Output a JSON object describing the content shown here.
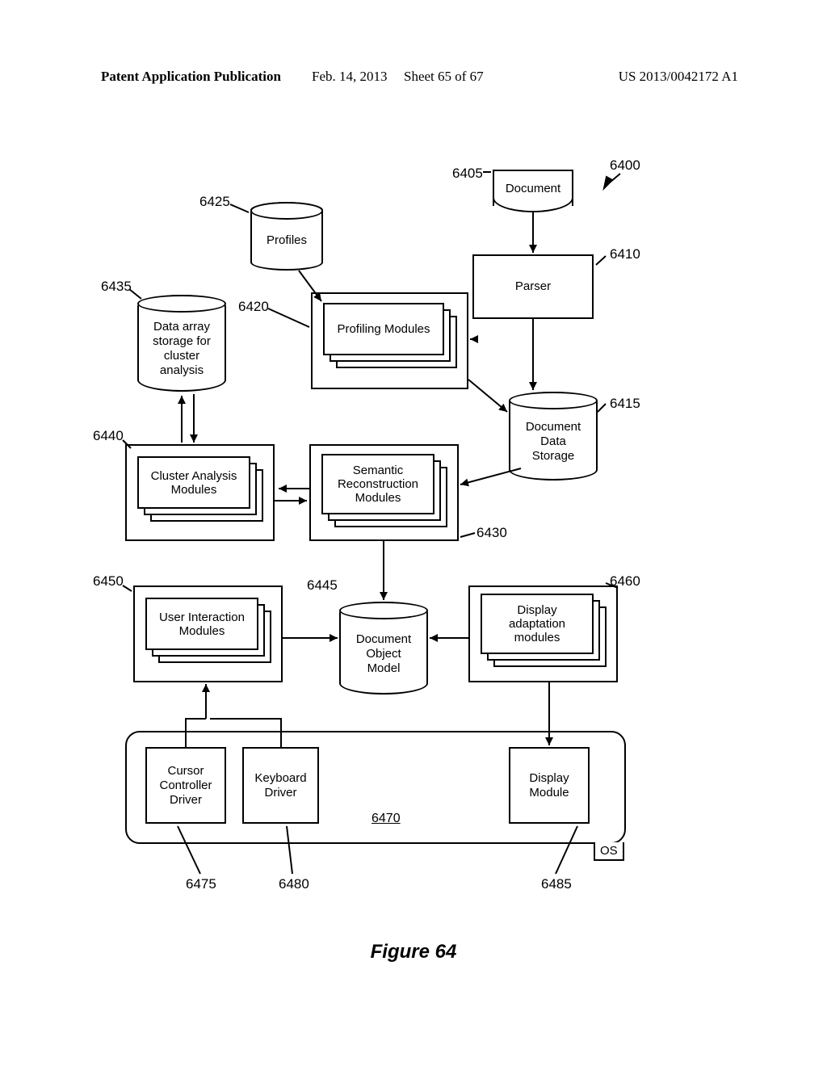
{
  "header": {
    "left": "Patent Application Publication",
    "mid1": "Feb. 14, 2013",
    "mid2": "Sheet 65 of 67",
    "right": "US 2013/0042172 A1"
  },
  "refs": {
    "r6400": "6400",
    "r6405": "6405",
    "r6410": "6410",
    "r6415": "6415",
    "r6420": "6420",
    "r6425": "6425",
    "r6430": "6430",
    "r6435": "6435",
    "r6440": "6440",
    "r6445": "6445",
    "r6450": "6450",
    "r6460": "6460",
    "r6470": "6470",
    "r6475": "6475",
    "r6480": "6480",
    "r6485": "6485"
  },
  "nodes": {
    "document": "Document",
    "parser": "Parser",
    "profiles": "Profiles",
    "profiling_modules": "Profiling Modules",
    "doc_data_storage_l1": "Document",
    "doc_data_storage_l2": "Data",
    "doc_data_storage_l3": "Storage",
    "data_array_l1": "Data array",
    "data_array_l2": "storage for",
    "data_array_l3": "cluster",
    "data_array_l4": "analysis",
    "cluster_l1": "Cluster Analysis",
    "cluster_l2": "Modules",
    "semantic_l1": "Semantic",
    "semantic_l2": "Reconstruction",
    "semantic_l3": "Modules",
    "dom_l1": "Document",
    "dom_l2": "Object",
    "dom_l3": "Model",
    "ui_l1": "User Interaction",
    "ui_l2": "Modules",
    "display_adapt_l1": "Display",
    "display_adapt_l2": "adaptation",
    "display_adapt_l3": "modules",
    "cursor_l1": "Cursor",
    "cursor_l2": "Controller",
    "cursor_l3": "Driver",
    "keyboard_l1": "Keyboard",
    "keyboard_l2": "Driver",
    "display_mod_l1": "Display",
    "display_mod_l2": "Module",
    "os": "OS"
  },
  "figure_caption": "Figure 64"
}
